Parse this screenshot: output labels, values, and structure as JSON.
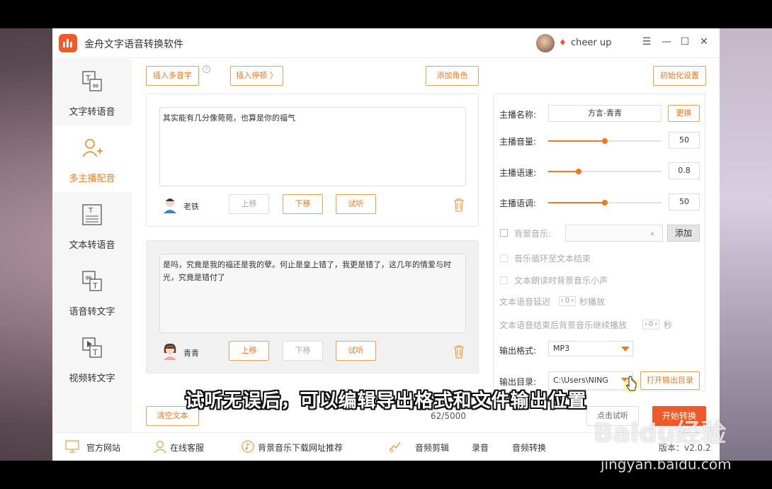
{
  "app": {
    "title": "金舟文字语音转换软件",
    "username": "cheer up",
    "window_controls": [
      "menu-icon",
      "minimize-icon",
      "maximize-icon",
      "close-icon"
    ]
  },
  "sidebar": {
    "items": [
      {
        "label": "文字转语音",
        "icon": "text-to-speech-icon",
        "active": false
      },
      {
        "label": "多主播配音",
        "icon": "add-user-icon",
        "active": true
      },
      {
        "label": "文本转语音",
        "icon": "document-icon",
        "active": false
      },
      {
        "label": "语音转文字",
        "icon": "speech-to-text-icon",
        "active": false
      },
      {
        "label": "视频转文字",
        "icon": "video-to-text-icon",
        "active": false
      }
    ]
  },
  "toolbar": {
    "insert_polyphone": "插入多音字",
    "insert_pause": "插入停顿 〉",
    "add_role": "添加角色",
    "init_settings": "初始化设置"
  },
  "cards": [
    {
      "text": "其实能有几分像菀菀，也算是你的福气",
      "speaker": "老铁",
      "move_up": "上移",
      "move_down": "下移",
      "preview": "试听"
    },
    {
      "text": "是吗，究竟是我的福还是我的孽。何止是皇上错了，我更是错了，这几年的情爱与时光，究竟是错付了",
      "speaker": "青青",
      "move_up": "上移",
      "move_down": "下移",
      "preview": "试听"
    }
  ],
  "panel": {
    "anchor_name_label": "主播名称:",
    "anchor_name_value": "方言-青青",
    "change_button": "更换",
    "volume_label": "主播音量:",
    "volume_value": "50",
    "volume_level": 0.5,
    "speed_label": "主播语速:",
    "speed_value": "0.8",
    "speed_level": 0.27,
    "pitch_label": "主播语调:",
    "pitch_value": "50",
    "pitch_level": 0.5,
    "bg_music_label": "背景音乐:",
    "add_button": "添加",
    "loop_music_label": "音乐循环至文本结束",
    "lower_music_label": "文本朗读时背景音乐小声",
    "delay_label_prefix": "文本语音延迟",
    "delay_value": "0",
    "delay_label_suffix": "秒播放",
    "continue_label_prefix": "文本语音结束后背景音乐继续播放",
    "continue_value": "0",
    "continue_label_suffix": "秒",
    "format_label": "输出格式:",
    "format_value": "MP3",
    "dir_label": "输出目录:",
    "dir_value": "C:\\Users\\NING",
    "open_dir_button": "打开输出目录"
  },
  "footer_actions": {
    "clear_text": "清空文本",
    "char_count": "62/5000",
    "preview_button": "点击试听",
    "start_button": "开始转换"
  },
  "bottombar": {
    "items": [
      "官方网站",
      "在线客服",
      "背景音乐下载网址推荐",
      "音频剪辑",
      "录音",
      "音频转换"
    ],
    "version": "版本：v2.0.2"
  },
  "overlay": {
    "caption": "试听无误后，可以编辑导出格式和文件输出位置",
    "watermark_logo": "Baidu经验",
    "watermark_url": "jingyan.baidu.com"
  },
  "colors": {
    "accent": "#f07820",
    "start_button": "#f05a28"
  }
}
